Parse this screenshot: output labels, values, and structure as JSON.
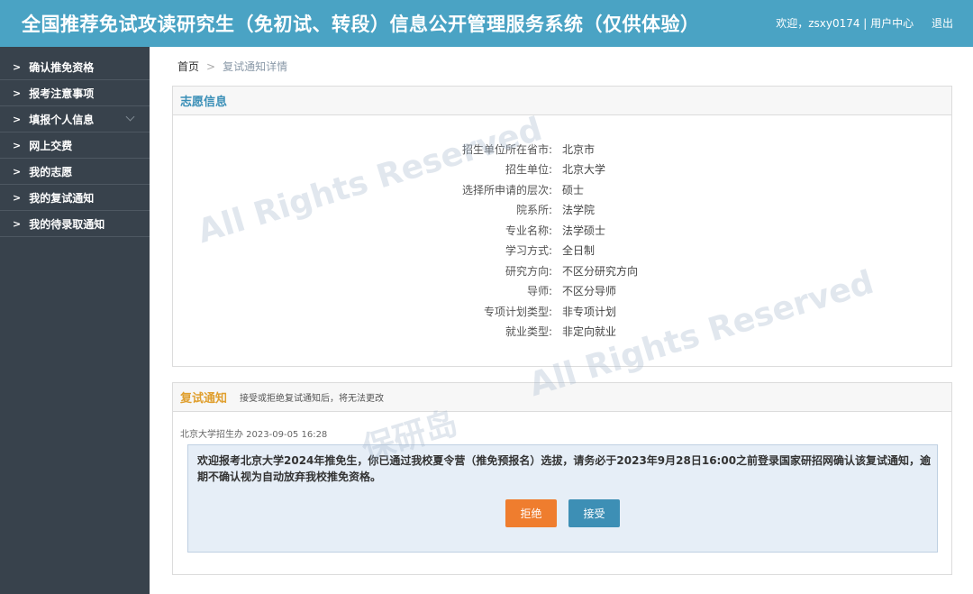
{
  "header": {
    "title": "全国推荐免试攻读研究生（免初试、转段）信息公开管理服务系统（仅供体验）",
    "welcome": "欢迎，zsxy0174 | 用户中心",
    "logout": "退出"
  },
  "sidebar": {
    "items": [
      {
        "label": "确认推免资格"
      },
      {
        "label": "报考注意事项"
      },
      {
        "label": "填报个人信息"
      },
      {
        "label": "网上交费"
      },
      {
        "label": "我的志愿"
      },
      {
        "label": "我的复试通知"
      },
      {
        "label": "我的待录取通知"
      }
    ]
  },
  "breadcrumb": {
    "home": "首页",
    "sep": ">",
    "current": "复试通知详情"
  },
  "volunteer": {
    "title": "志愿信息",
    "rows": [
      {
        "label": "招生单位所在省市:",
        "value": "北京市"
      },
      {
        "label": "招生单位:",
        "value": "北京大学"
      },
      {
        "label": "选择所申请的层次:",
        "value": "硕士"
      },
      {
        "label": "院系所:",
        "value": "法学院"
      },
      {
        "label": "专业名称:",
        "value": "法学硕士"
      },
      {
        "label": "学习方式:",
        "value": "全日制"
      },
      {
        "label": "研究方向:",
        "value": "不区分研究方向"
      },
      {
        "label": "导师:",
        "value": "不区分导师"
      },
      {
        "label": "专项计划类型:",
        "value": "非专项计划"
      },
      {
        "label": "就业类型:",
        "value": "非定向就业"
      }
    ]
  },
  "interview": {
    "title": "复试通知",
    "note": "接受或拒绝复试通知后，将无法更改",
    "source": "北京大学招生办 2023-09-05 16:28",
    "message": "欢迎报考北京大学2024年推免生，你已通过我校夏令营（推免预报名）选拔，请务必于2023年9月28日16:00之前登录国家研招网确认该复试通知，逾期不确认视为自动放弃我校推免资格。",
    "reject_label": "拒绝",
    "accept_label": "接受"
  },
  "watermark": {
    "text1": "All Rights Reserved",
    "text2": "All Rights Reserved",
    "text3": "保研岛"
  },
  "colors": {
    "header_bg": "#4aa3c4",
    "sidebar_bg": "#38424c",
    "reject": "#ef7d2e",
    "accept": "#3d8fb5"
  }
}
